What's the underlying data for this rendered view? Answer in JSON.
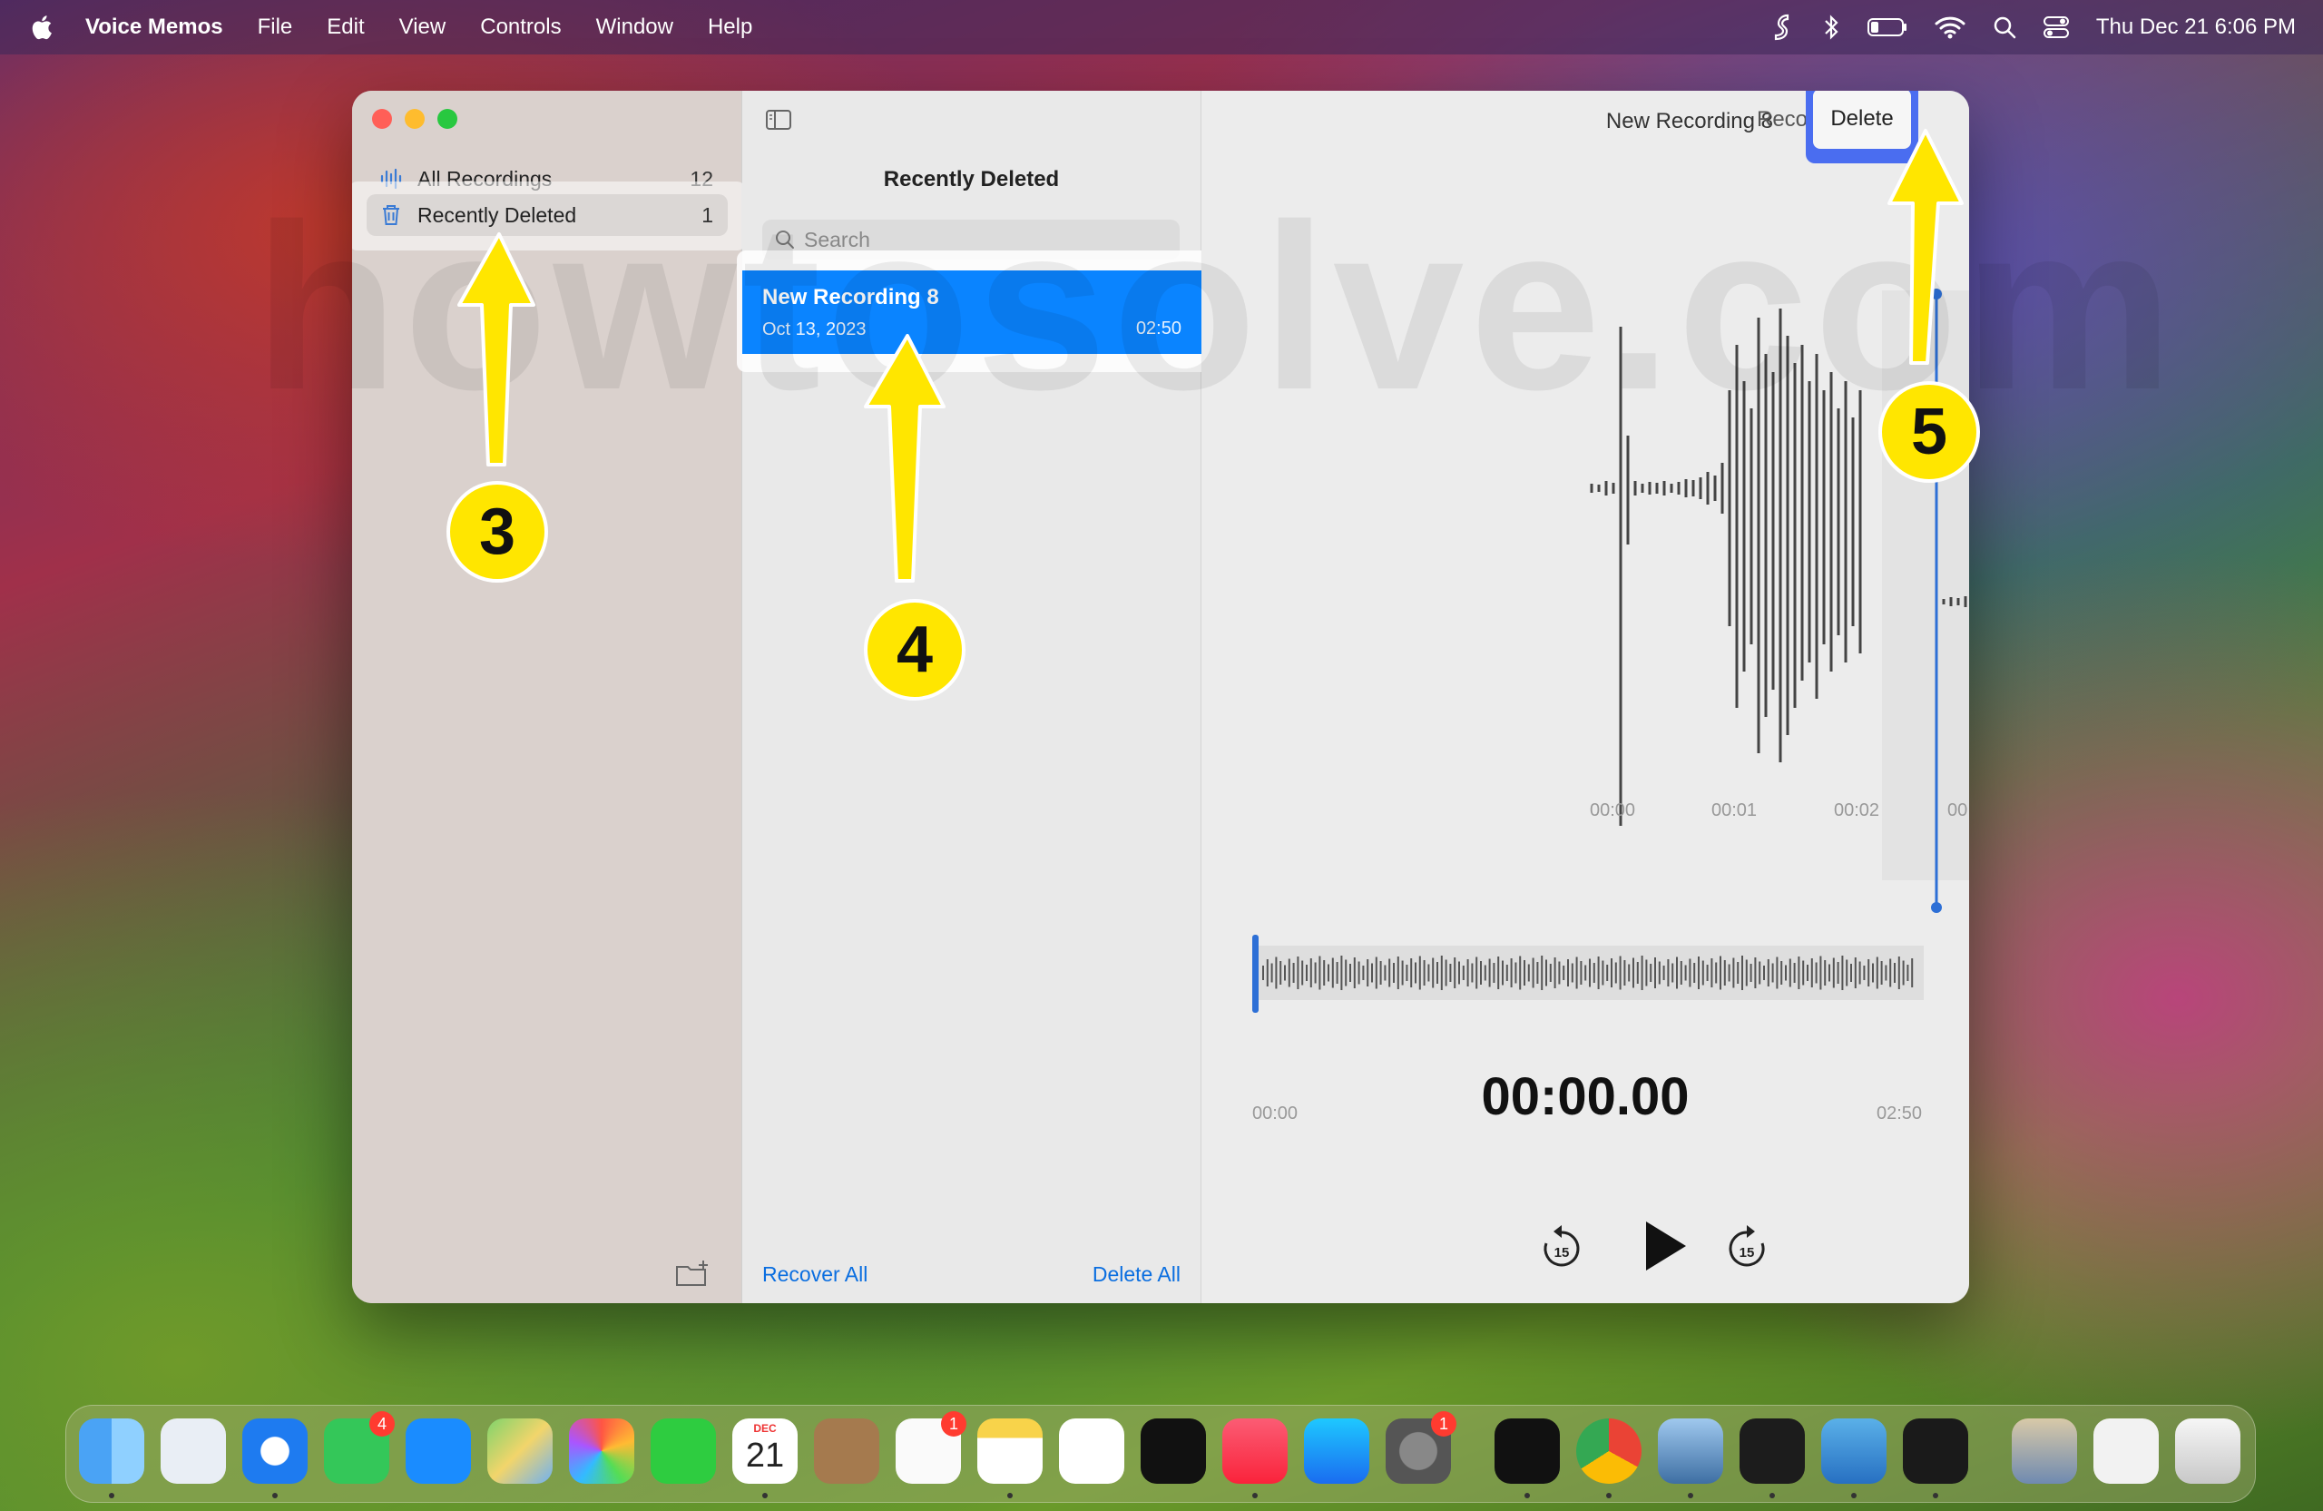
{
  "menubar": {
    "app_name": "Voice Memos",
    "items": [
      "File",
      "Edit",
      "View",
      "Controls",
      "Window",
      "Help"
    ],
    "datetime": "Thu Dec 21  6:06 PM"
  },
  "watermark": "howtosolve.com",
  "window": {
    "title": "New Recording 8",
    "recover_label": "Recover",
    "delete_label": "Delete"
  },
  "sidebar": {
    "items": [
      {
        "label": "All Recordings",
        "count": "12"
      },
      {
        "label": "Recently Deleted",
        "count": "1"
      }
    ]
  },
  "list": {
    "title": "Recently Deleted",
    "search_placeholder": "Search",
    "recordings": [
      {
        "title": "New Recording 8",
        "date": "Oct 13, 2023",
        "duration": "02:50"
      }
    ],
    "recover_all": "Recover All",
    "delete_all": "Delete All"
  },
  "detail": {
    "timeline_labels": [
      "00:00",
      "00:01",
      "00:02",
      "00"
    ],
    "overview_start": "00:00",
    "overview_end": "02:50",
    "current_time": "00:00.00",
    "skip_back": "15",
    "skip_forward": "15"
  },
  "annotations": {
    "step3": "3",
    "step4": "4",
    "step5": "5"
  },
  "dock": {
    "calendar_month": "DEC",
    "calendar_day": "21",
    "messages_badge": "4",
    "reminders_badge": "1",
    "settings_badge": "1"
  },
  "colors": {
    "accent": "#0a84ff",
    "annotation": "#ffe600",
    "delete_highlight": "#4a6df0"
  }
}
